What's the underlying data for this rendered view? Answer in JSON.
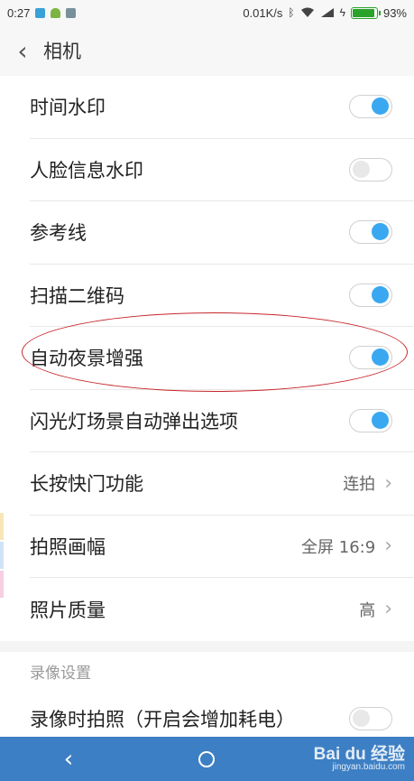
{
  "status_bar": {
    "time": "0:27",
    "network_speed": "0.01K/s",
    "battery_percent": "93%",
    "battery_level": 0.93,
    "icons": [
      "notification-shield-icon",
      "android-icon",
      "notification-app-icon",
      "bluetooth-icon",
      "wifi-icon",
      "signal-icon",
      "charging-icon",
      "battery-icon"
    ]
  },
  "header": {
    "back_icon": "chevron-left-icon",
    "title": "相机"
  },
  "settings": [
    {
      "label": "时间水印",
      "type": "toggle",
      "on": true
    },
    {
      "label": "人脸信息水印",
      "type": "toggle",
      "on": false
    },
    {
      "label": "参考线",
      "type": "toggle",
      "on": true
    },
    {
      "label": "扫描二维码",
      "type": "toggle",
      "on": true
    },
    {
      "label": "自动夜景增强",
      "type": "toggle",
      "on": true
    },
    {
      "label": "闪光灯场景自动弹出选项",
      "type": "toggle",
      "on": true
    },
    {
      "label": "长按快门功能",
      "type": "select",
      "value": "连拍"
    },
    {
      "label": "拍照画幅",
      "type": "select",
      "value": "全屏 16:9"
    },
    {
      "label": "照片质量",
      "type": "select",
      "value": "高"
    }
  ],
  "video_section": {
    "header": "录像设置",
    "items": [
      {
        "label": "录像时拍照（开启会增加耗电）",
        "type": "toggle",
        "on": false
      }
    ]
  },
  "nav_bar": {
    "back_icon": "nav-back-icon",
    "home_icon": "nav-home-icon"
  },
  "watermark": {
    "main": "Bai du 经验",
    "sub": "jingyan.baidu.com"
  },
  "colors": {
    "accent": "#3aa8f0",
    "nav_bar": "#3d7fc4",
    "annotation": "#c8262a"
  }
}
